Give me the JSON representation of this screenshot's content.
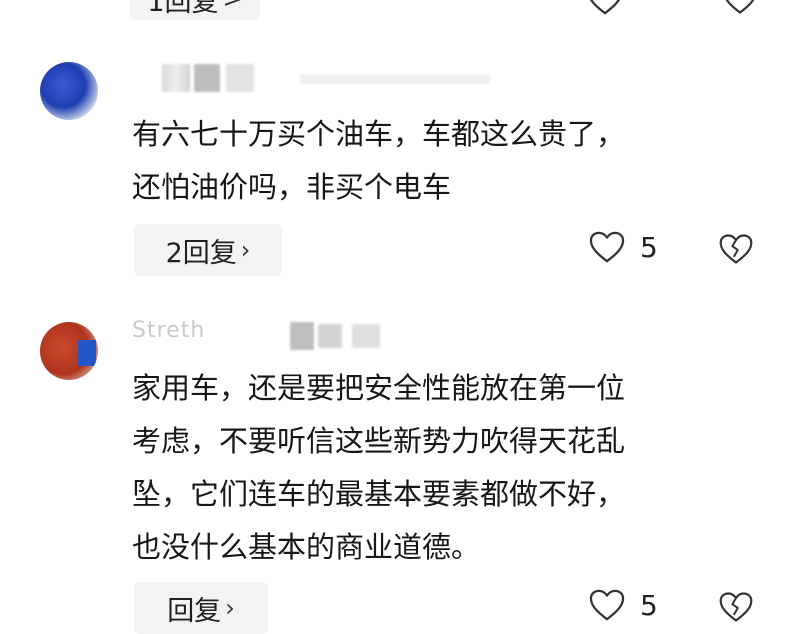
{
  "top_reply": {
    "label": "1回复",
    "chevron": ">"
  },
  "top_actions": {
    "icons": [
      "heart-icon",
      "broken-heart-icon"
    ]
  },
  "comments": [
    {
      "username": "",
      "text_lines": [
        "有六七十万买个油车，车都这么贵了，",
        "还怕油价吗，非买个电车"
      ],
      "reply_label": "2回复",
      "like_count": "5",
      "avatar_color": "#2a4bc4"
    },
    {
      "username": "Streth",
      "text_lines": [
        "家用车，还是要把安全性能放在第一位",
        "考虑，不要听信这些新势力吹得天花乱",
        "坠，它们连车的最基本要素都做不好，",
        "也没什么基本的商业道德。"
      ],
      "reply_label": "回复",
      "like_count": "5",
      "avatar_color": "#c0432a"
    }
  ],
  "colors": {
    "pill_bg": "#f3f3f3",
    "text": "#171717",
    "icon": "#333333"
  }
}
